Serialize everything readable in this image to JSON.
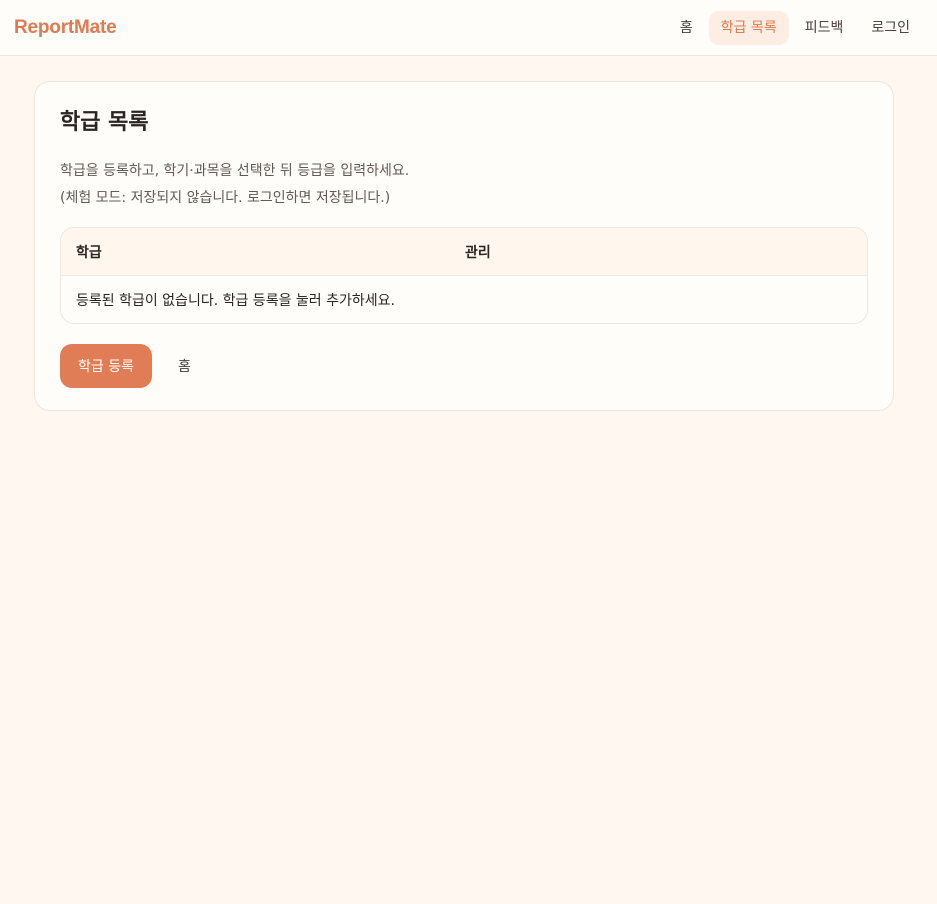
{
  "app": {
    "brand": "ReportMate"
  },
  "nav": {
    "items": [
      {
        "label": "홈"
      },
      {
        "label": "학급 목록"
      },
      {
        "label": "피드백"
      },
      {
        "label": "로그인"
      }
    ]
  },
  "main": {
    "title": "학급 목록",
    "description": "학급을 등록하고, 학기·과목을 선택한 뒤 등급을 입력하세요.",
    "trial_note": "(체험 모드: 저장되지 않습니다. 로그인하면 저장됩니다.)",
    "table": {
      "columns": [
        "학급",
        "관리"
      ],
      "empty_message": "등록된 학급이 없습니다. 학급 등록을 눌러 추가하세요."
    },
    "actions": {
      "register_label": "학급 등록",
      "home_label": "홈"
    }
  },
  "colors": {
    "accent": "#e07d56",
    "background": "#fff7f0"
  }
}
